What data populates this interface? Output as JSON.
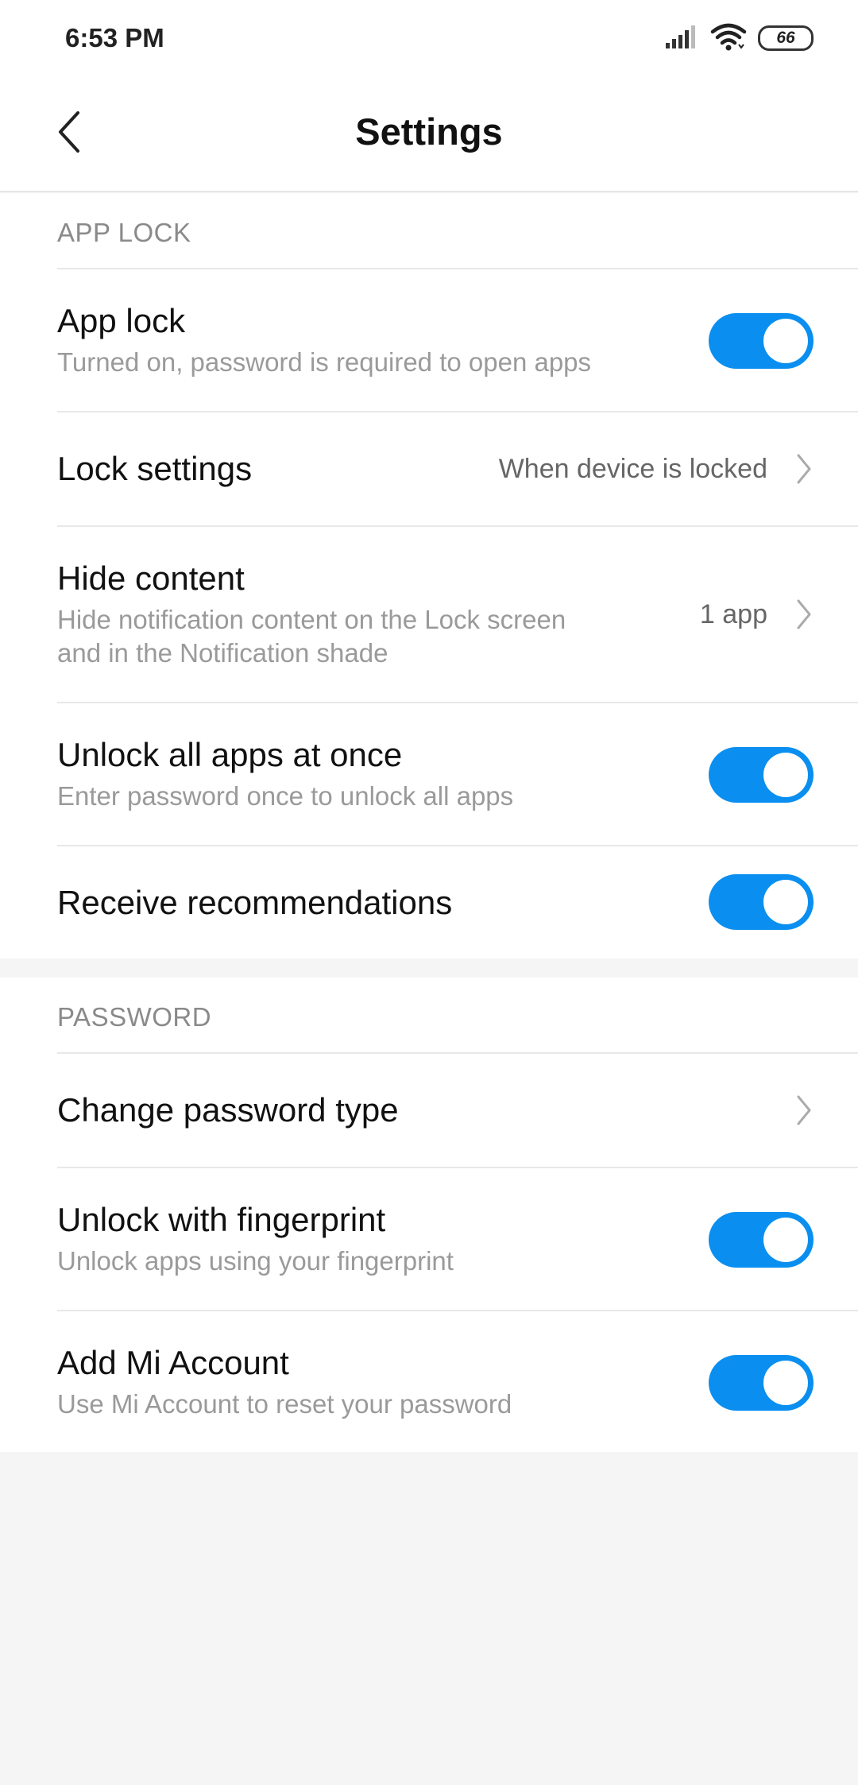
{
  "status_bar": {
    "time": "6:53 PM",
    "battery": "66",
    "icons": [
      "signal-icon",
      "wifi-icon",
      "battery-icon"
    ]
  },
  "header": {
    "title": "Settings",
    "back_icon": "back-arrow-icon"
  },
  "sections": [
    {
      "header": "APP LOCK",
      "rows": [
        {
          "title": "App lock",
          "subtitle": "Turned on, password is required to open apps",
          "toggle": true
        },
        {
          "title": "Lock settings",
          "value": "When device is locked",
          "chevron": true
        },
        {
          "title": "Hide content",
          "subtitle_line1": "Hide notification content on the Lock screen",
          "subtitle_line2": "and in the Notification shade",
          "value": "1 app",
          "chevron": true
        },
        {
          "title": "Unlock all apps at once",
          "subtitle": "Enter password once to unlock all apps",
          "toggle": true
        },
        {
          "title": "Receive recommendations",
          "toggle": true
        }
      ]
    },
    {
      "header": "PASSWORD",
      "rows": [
        {
          "title": "Change password type",
          "chevron": true
        },
        {
          "title": "Unlock with fingerprint",
          "subtitle": "Unlock apps using your fingerprint",
          "toggle": true
        },
        {
          "title": "Add Mi Account",
          "subtitle": "Use Mi Account to reset your password",
          "toggle": true
        }
      ]
    }
  ],
  "colors": {
    "accent": "#0a8ff0",
    "background": "#f5f5f5",
    "surface": "#ffffff",
    "secondary_text": "#9a9a9a"
  }
}
